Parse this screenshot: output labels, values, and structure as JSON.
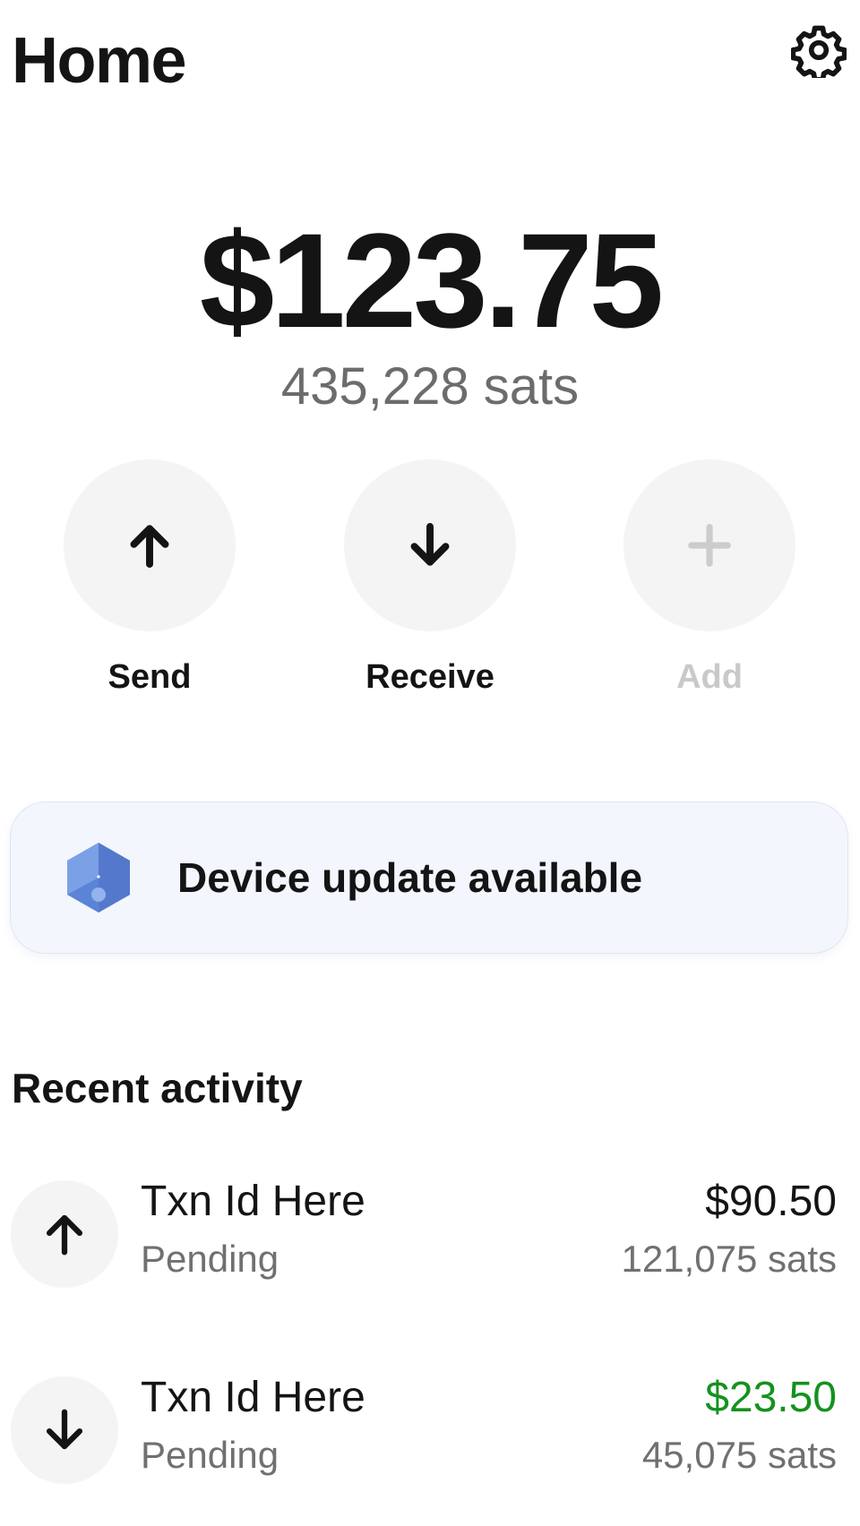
{
  "header": {
    "title": "Home",
    "settings_icon": "gear-icon"
  },
  "balance": {
    "fiat": "$123.75",
    "sats": "435,228 sats"
  },
  "actions": [
    {
      "label": "Send",
      "icon": "arrow-up-icon",
      "enabled": true
    },
    {
      "label": "Receive",
      "icon": "arrow-down-icon",
      "enabled": true
    },
    {
      "label": "Add",
      "icon": "plus-icon",
      "enabled": false
    }
  ],
  "banner": {
    "text": "Device update available",
    "icon": "device-icon",
    "accent_color": "#5b84d6"
  },
  "recent_activity": {
    "title": "Recent activity",
    "transactions": [
      {
        "direction": "sent",
        "icon": "arrow-up-icon",
        "title": "Txn Id Here",
        "status": "Pending",
        "amount": "$90.50",
        "sats": "121,075 sats",
        "amount_color": "#141414"
      },
      {
        "direction": "received",
        "icon": "arrow-down-icon",
        "title": "Txn Id Here",
        "status": "Pending",
        "amount": "$23.50",
        "sats": "45,075 sats",
        "amount_color": "#15911f"
      }
    ]
  }
}
